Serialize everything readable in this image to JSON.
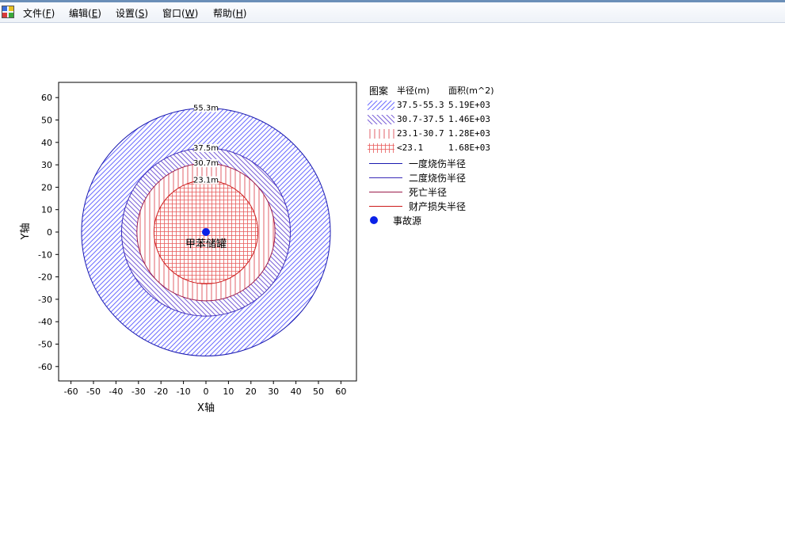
{
  "menu": {
    "items": [
      {
        "text": "文件(",
        "acc": "F",
        "end": ")"
      },
      {
        "text": "编辑(",
        "acc": "E",
        "end": ")"
      },
      {
        "text": "设置(",
        "acc": "S",
        "end": ")"
      },
      {
        "text": "窗口(",
        "acc": "W",
        "end": ")"
      },
      {
        "text": "帮助(",
        "acc": "H",
        "end": ")"
      }
    ]
  },
  "legend": {
    "header": {
      "pattern": "图案",
      "radius": "半径(m)",
      "area": "面积(m^2)"
    },
    "zones": [
      {
        "range": "37.5-55.3",
        "area": "5.19E+03",
        "pattern": "diag-right",
        "color": "#6b6bff"
      },
      {
        "range": "30.7-37.5",
        "area": "1.46E+03",
        "pattern": "diag-left",
        "color": "#7a5fd8"
      },
      {
        "range": "23.1-30.7",
        "area": "1.28E+03",
        "pattern": "vertical",
        "color": "#e0606a"
      },
      {
        "range": "<23.1",
        "area": "1.68E+03",
        "pattern": "grid",
        "color": "#e85a5a"
      }
    ],
    "lines": [
      {
        "label": "一度烧伤半径",
        "color": "#1a1ab0"
      },
      {
        "label": "二度烧伤半径",
        "color": "#3a2ab8"
      },
      {
        "label": "死亡半径",
        "color": "#9a1a4a"
      },
      {
        "label": "财产损失半径",
        "color": "#cc1a1a"
      }
    ],
    "source_label": "事故源",
    "source_color": "#0a21e8"
  },
  "chart_data": {
    "type": "scatter",
    "title": "",
    "xlabel": "X轴",
    "ylabel": "Y轴",
    "xlim": [
      -65,
      65
    ],
    "ylim": [
      -66,
      66
    ],
    "xticks": [
      -60,
      -50,
      -40,
      -30,
      -20,
      -10,
      0,
      10,
      20,
      30,
      40,
      50,
      60
    ],
    "yticks": [
      60,
      50,
      40,
      30,
      20,
      10,
      0,
      -10,
      -20,
      -30,
      -40,
      -50,
      -60
    ],
    "circles": [
      {
        "radius": 55.3,
        "label": "55.3m",
        "color": "#1a1ab0",
        "fill": "diag-right"
      },
      {
        "radius": 37.5,
        "label": "37.5m",
        "color": "#3a2ab8",
        "fill": "diag-left"
      },
      {
        "radius": 30.7,
        "label": "30.7m",
        "color": "#9a1a4a",
        "fill": "vertical"
      },
      {
        "radius": 23.1,
        "label": "23.1m",
        "color": "#cc1a1a",
        "fill": "grid"
      }
    ],
    "source": {
      "x": 0,
      "y": 0,
      "label": "甲苯储罐",
      "color": "#0a21e8"
    }
  }
}
